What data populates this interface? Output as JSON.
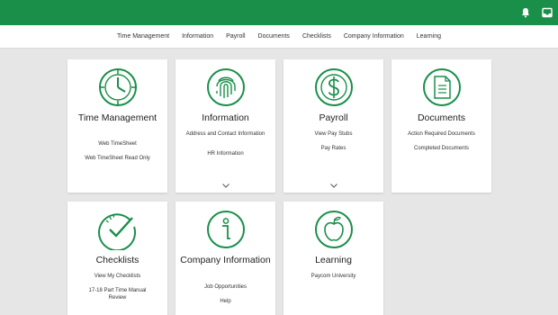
{
  "colors": {
    "header": "#1a8f4a",
    "accent": "#1a8f4a"
  },
  "topbar": {
    "icons": [
      "bell-icon",
      "inbox-icon"
    ]
  },
  "nav": [
    "Time Management",
    "Information",
    "Payroll",
    "Documents",
    "Checklists",
    "Company Information",
    "Learning"
  ],
  "cards": {
    "time": {
      "title": "Time Management",
      "links": [
        "Web TimeSheet",
        "Web TimeSheet Read Only"
      ],
      "icon": "clock-icon"
    },
    "info": {
      "title": "Information",
      "links": [
        "Address and Contact Information",
        "HR Information"
      ],
      "icon": "fingerprint-icon"
    },
    "payroll": {
      "title": "Payroll",
      "links": [
        "View Pay Stubs",
        "Pay Rates"
      ],
      "icon": "dollar-icon"
    },
    "docs": {
      "title": "Documents",
      "links": [
        "Action Required Documents",
        "Completed Documents"
      ],
      "icon": "document-icon"
    },
    "check": {
      "title": "Checklists",
      "links": [
        "View My Checklists",
        "17-18 Part Time Manual Review"
      ],
      "icon": "checkmark-icon"
    },
    "company": {
      "title": "Company Information",
      "links": [
        "Job Opportunities",
        "Help"
      ],
      "icon": "info-icon"
    },
    "learning": {
      "title": "Learning",
      "links": [
        "Paycom University"
      ],
      "icon": "apple-icon"
    }
  }
}
